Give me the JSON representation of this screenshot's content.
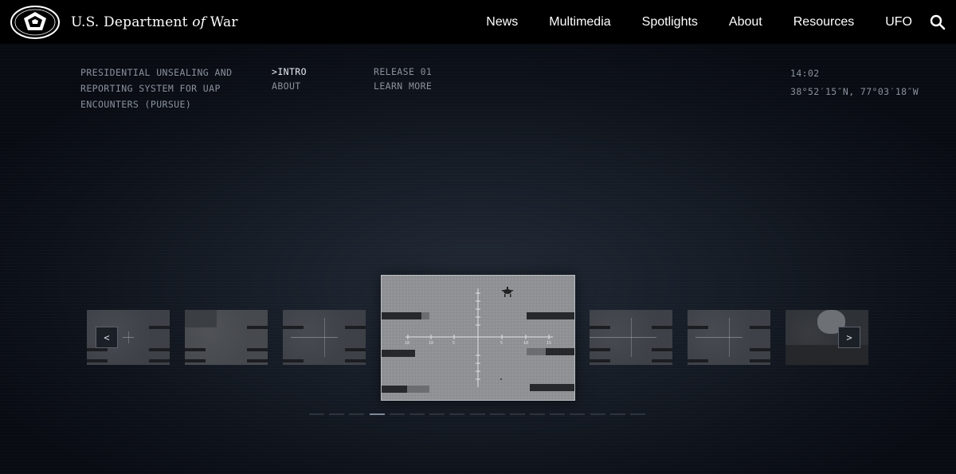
{
  "header": {
    "brand_prefix": "U.S. Department ",
    "brand_of": "of",
    "brand_suffix": " War",
    "nav": [
      "News",
      "Multimedia",
      "Spotlights",
      "About",
      "Resources",
      "UFO"
    ],
    "search_icon": "search-icon",
    "seal_icon": "pentagon-seal-icon"
  },
  "hero": {
    "program_title": "PRESIDENTIAL UNSEALING AND REPORTING SYSTEM FOR UAP ENCOUNTERS (PURSUE)",
    "menu": {
      "intro": ">INTRO",
      "about": "ABOUT",
      "release": "RELEASE 01",
      "learn_more": "LEARN MORE"
    },
    "time": "14:02",
    "coordinates": "38°52′15″N, 77°03′18″W"
  },
  "carousel": {
    "prev_label": "<",
    "next_label": ">",
    "reticle_labels": [
      "18",
      "10",
      "5",
      "5",
      "10",
      "15"
    ],
    "slide_count": 17,
    "active_index": 3
  },
  "colors": {
    "header_bg": "#000000",
    "hero_bg": "#161c26",
    "text_muted": "#8a919c",
    "text_active": "#e8ecf2"
  }
}
